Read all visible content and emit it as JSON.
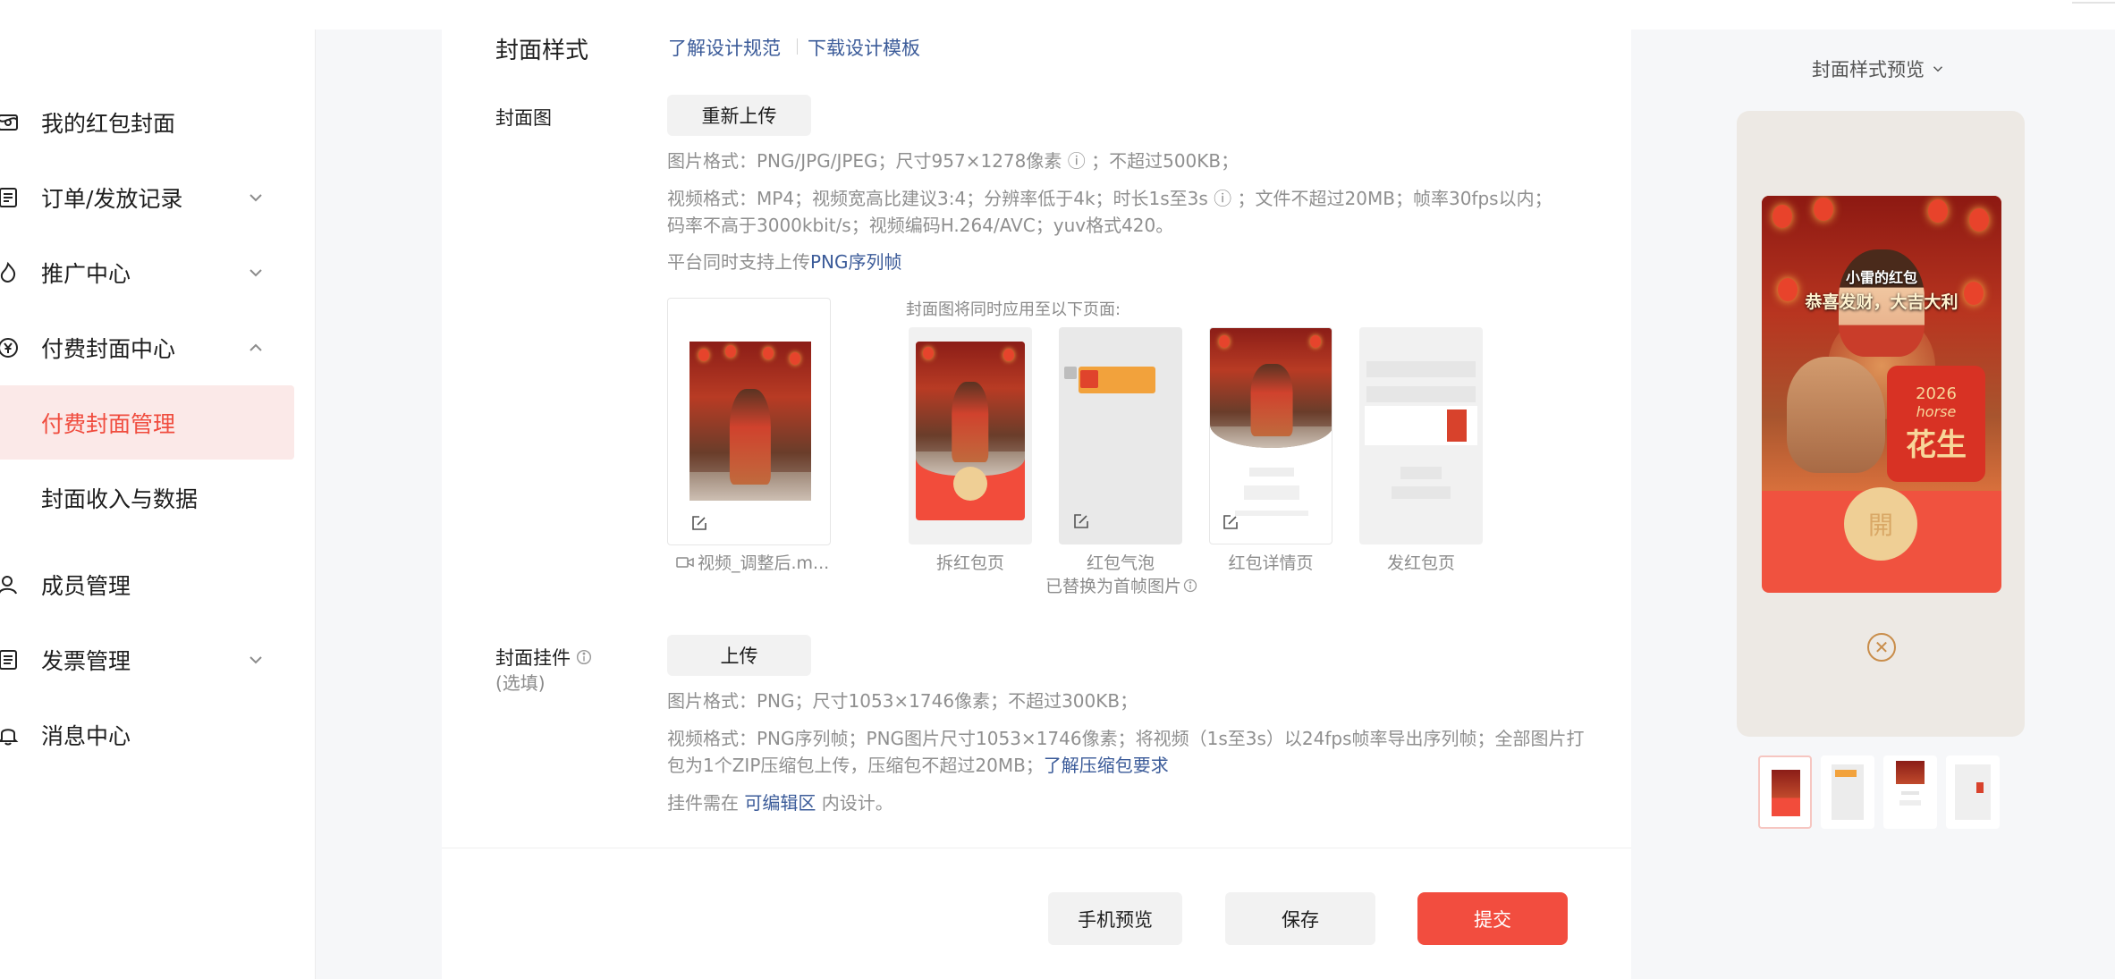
{
  "sidebar": {
    "items": [
      {
        "label": "我的红包封面",
        "icon": "envelope-icon"
      },
      {
        "label": "订单/发放记录",
        "icon": "list-icon",
        "expand": "down"
      },
      {
        "label": "推广中心",
        "icon": "flame-icon",
        "expand": "down"
      },
      {
        "label": "付费封面中心",
        "icon": "yen-circle-icon",
        "expand": "up"
      },
      {
        "label": "付费封面管理",
        "active": true
      },
      {
        "label": "封面收入与数据"
      },
      {
        "label": "成员管理",
        "icon": "user-icon"
      },
      {
        "label": "发票管理",
        "icon": "invoice-icon",
        "expand": "down"
      },
      {
        "label": "消息中心",
        "icon": "bell-icon"
      }
    ]
  },
  "section": {
    "title": "封面样式",
    "link1": "了解设计规范",
    "link2": "下载设计模板"
  },
  "cover": {
    "label": "封面图",
    "reupload": "重新上传",
    "hint_image": "图片格式：PNG/JPG/JPEG；尺寸957×1278像素 ⓘ ；不超过500KB；",
    "hint_video": "视频格式：MP4；视频宽高比建议3:4；分辨率低于4k；时长1s至3s ⓘ ；文件不超过20MB；帧率30fps以内；码率不高于3000kbit/s；视频编码H.264/AVC；yuv格式420。",
    "hint_png_prefix": "平台同时支持上传",
    "hint_png_link": "PNG序列帧",
    "file_name": "视频_调整后.m...",
    "apply_note": "封面图将同时应用至以下页面:",
    "previews": [
      "拆红包页",
      "红包气泡",
      "红包详情页",
      "发红包页"
    ],
    "bubble_note": "已替换为首帧图片"
  },
  "pendant": {
    "label": "封面挂件",
    "optional": "(选填)",
    "upload": "上传",
    "hint_image": "图片格式：PNG；尺寸1053×1746像素；不超过300KB；",
    "hint_video": "视频格式：PNG序列帧；PNG图片尺寸1053×1746像素；将视频（1s至3s）以24fps帧率导出序列帧；全部图片打包为1个ZIP压缩包上传，压缩包不超过20MB；",
    "hint_video_link": "了解压缩包要求",
    "hint_area_prefix": "挂件需在",
    "hint_area_link": "可编辑区",
    "hint_area_suffix": "内设计。"
  },
  "actions": {
    "phone_preview": "手机预览",
    "save": "保存",
    "submit": "提交"
  },
  "preview": {
    "title": "封面样式预览",
    "line1": "小雷的红包",
    "line2": "恭喜发财，大吉大利",
    "year": "2026",
    "horse": "horse",
    "slogan": "花生",
    "open": "開"
  },
  "colors": {
    "accent": "#f24d3f",
    "link": "#3b5b99",
    "active_bg": "#fbe9e8"
  }
}
